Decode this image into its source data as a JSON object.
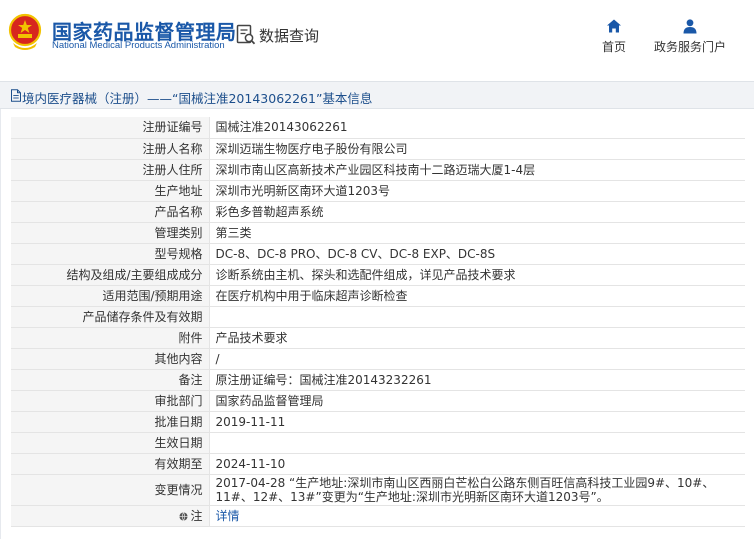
{
  "header": {
    "logo_cn": "国家药品监督管理局",
    "logo_en": "National Medical Products Administration",
    "query_label": "数据查询",
    "nav": [
      {
        "label": "首页",
        "icon": "home-icon"
      },
      {
        "label": "政务服务门户",
        "icon": "user-icon"
      }
    ]
  },
  "breadcrumb": {
    "text": "境内医疗器械（注册）——“国械注准20143062261”基本信息",
    "icon": "document-icon"
  },
  "colors": {
    "brand_blue": "#1a58a8",
    "emblem_red": "#d7261e",
    "emblem_gold": "#f2c200"
  },
  "record": {
    "rows": [
      {
        "label": "注册证编号",
        "value": "国械注准20143062261"
      },
      {
        "label": "注册人名称",
        "value": "深圳迈瑞生物医疗电子股份有限公司"
      },
      {
        "label": "注册人住所",
        "value": "深圳市南山区高新技术产业园区科技南十二路迈瑞大厦1-4层"
      },
      {
        "label": "生产地址",
        "value": "深圳市光明新区南环大道1203号"
      },
      {
        "label": "产品名称",
        "value": "彩色多普勒超声系统"
      },
      {
        "label": "管理类别",
        "value": "第三类"
      },
      {
        "label": "型号规格",
        "value": "DC-8、DC-8 PRO、DC-8 CV、DC-8 EXP、DC-8S"
      },
      {
        "label": "结构及组成/主要组成成分",
        "value": "诊断系统由主机、探头和选配件组成，详见产品技术要求"
      },
      {
        "label": "适用范围/预期用途",
        "value": "在医疗机构中用于临床超声诊断检查"
      },
      {
        "label": "产品储存条件及有效期",
        "value": ""
      },
      {
        "label": "附件",
        "value": "产品技术要求"
      },
      {
        "label": "其他内容",
        "value": "/"
      },
      {
        "label": "备注",
        "value": "原注册证编号：国械注准20143232261"
      },
      {
        "label": "审批部门",
        "value": "国家药品监督管理局"
      },
      {
        "label": "批准日期",
        "value": "2019-11-11"
      },
      {
        "label": "生效日期",
        "value": ""
      },
      {
        "label": "有效期至",
        "value": "2024-11-10"
      },
      {
        "label": "变更情况",
        "value": "2017-04-28 “生产地址:深圳市南山区西丽白芒松白公路东侧百旺信高科技工业园9#、10#、11#、12#、13#”变更为“生产地址:深圳市光明新区南环大道1203号”。"
      }
    ],
    "note": {
      "label": "注",
      "link": "详情",
      "icon": "globe-icon"
    }
  }
}
